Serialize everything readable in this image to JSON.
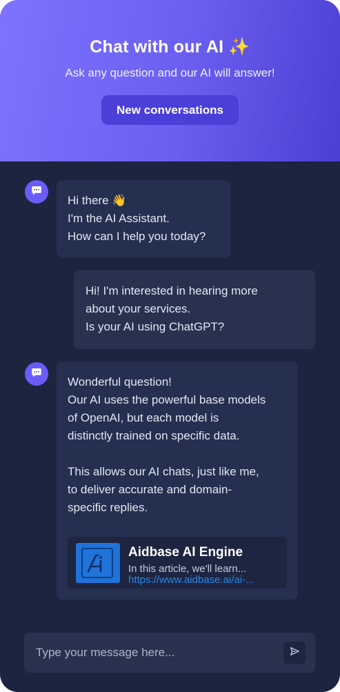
{
  "header": {
    "title": "Chat with our AI ✨",
    "subtitle": "Ask any question and our AI will answer!",
    "new_conversation_label": "New conversations"
  },
  "messages": [
    {
      "role": "assistant",
      "lines": [
        "Hi there 👋",
        "I'm the AI Assistant.",
        "How can I help you today?"
      ]
    },
    {
      "role": "user",
      "lines": [
        "Hi! I'm interested in hearing more",
        "about your services.",
        "Is your AI using ChatGPT?"
      ]
    },
    {
      "role": "assistant",
      "paragraph1": [
        "Wonderful question!",
        "Our AI uses the powerful base models",
        "of OpenAI, but each model is",
        "distinctly trained on specific data."
      ],
      "paragraph2": [
        "This allows our AI chats, just like me,",
        "to deliver accurate and domain-",
        "specific replies."
      ],
      "link_card": {
        "title": "Aidbase AI Engine",
        "description": "In this article, we'll learn...",
        "url": "https://www.aidbase.ai/ai-..."
      }
    }
  ],
  "composer": {
    "placeholder": "Type your message here..."
  },
  "icons": {
    "avatar": "chat-bubble-icon",
    "send": "send-icon",
    "link_thumb": "aidbase-logo-icon"
  },
  "colors": {
    "header_gradient_start": "#7d73ff",
    "header_gradient_end": "#4a3fd2",
    "background": "#1c2440",
    "bubble": "#252f50",
    "accent": "#6b5bf7",
    "link": "#2e86e6"
  }
}
